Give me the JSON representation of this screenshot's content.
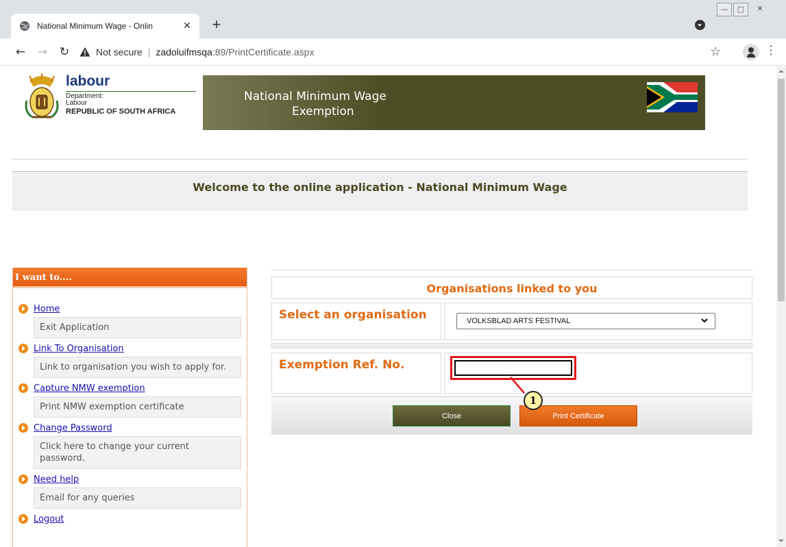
{
  "browser": {
    "tab_title": "National Minimum Wage - Onlin",
    "tab_close": "✕",
    "new_tab": "+",
    "security_label": "Not secure",
    "separator": "|",
    "url_host": "zadoluifmsqa",
    "url_path": ":89/PrintCertificate.aspx",
    "window_controls": {
      "minimize": "—",
      "maximize": "□",
      "close": "✕"
    }
  },
  "header": {
    "logo_name": "labour",
    "department_line1": "Department:",
    "department_line2": "Labour",
    "country": "REPUBLIC OF SOUTH AFRICA",
    "banner_line1": "National Minimum Wage",
    "banner_line2": "Exemption"
  },
  "welcome": {
    "text": "Welcome to the online application - National Minimum Wage"
  },
  "sidebar": {
    "title": "I want to....",
    "items": [
      {
        "label": "Home",
        "desc": "Exit Application"
      },
      {
        "label": "Link To Organisation",
        "desc": "Link to organisation you wish to apply for."
      },
      {
        "label": "Capture NMW exemption",
        "desc": "Print NMW exemption certificate"
      },
      {
        "label": "Change Password",
        "desc": "Click here to change your current password."
      },
      {
        "label": "Need help",
        "desc": "Email for any queries"
      },
      {
        "label": "Logout",
        "desc": ""
      }
    ]
  },
  "form": {
    "title": "Organisations linked to you",
    "select_label": "Select an organisation",
    "select_value": "VOLKSBLAD ARTS FESTIVAL",
    "ref_label": "Exemption Ref. No.",
    "ref_value": "",
    "close_button": "Close",
    "print_button": "Print Certificate"
  },
  "annotation": {
    "callout_number": "1"
  },
  "colors": {
    "accent_orange": "#e06a12",
    "banner_olive": "#4e4e26",
    "highlight_red": "#e01616"
  },
  "icons": {
    "tab_favicon": "globe-icon",
    "security": "warning-triangle-icon",
    "bookmark": "star-icon",
    "profile": "account-icon",
    "menu": "more-vert-icon",
    "bullet": "orange-arrow-bullet-icon"
  }
}
